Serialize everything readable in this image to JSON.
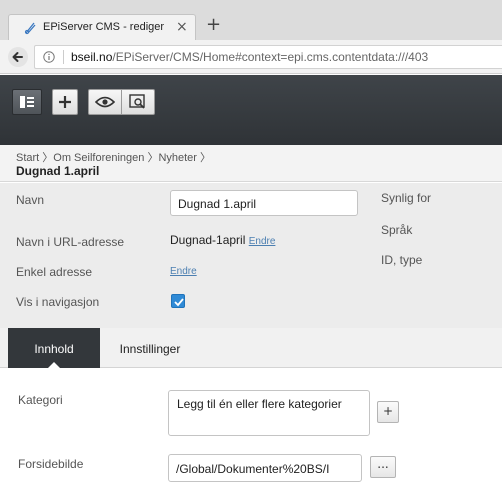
{
  "browser": {
    "tab_title": "EPiServer CMS - rediger",
    "close_glyph": "×",
    "new_tab_glyph": "+",
    "url_host": "bseil.no",
    "url_rest": "/EPiServer/CMS/Home#context=epi.cms.contentdata:///403"
  },
  "toolbar": {
    "icons": [
      "tree-toggle-icon",
      "add-icon",
      "view-icon",
      "preview-icon"
    ]
  },
  "header": {
    "breadcrumb": "Start 〉Om Seilforeningen 〉Nyheter 〉",
    "title": "Dugnad 1.april"
  },
  "properties": {
    "name_label": "Navn",
    "name_value": "Dugnad 1.april",
    "urlname_label": "Navn i URL-adresse",
    "urlname_value": "Dugnad-1april",
    "urlname_edit": "Endre",
    "simple_address_label": "Enkel adresse",
    "simple_address_edit": "Endre",
    "visible_nav_label": "Vis i navigasjon",
    "visible_nav_checked": true,
    "visible_for_label": "Synlig for",
    "language_label": "Språk",
    "id_type_label": "ID, type"
  },
  "tabs": [
    {
      "label": "Innhold",
      "active": true
    },
    {
      "label": "Innstillinger",
      "active": false
    }
  ],
  "content": {
    "category_label": "Kategori",
    "category_value": "Legg til én eller flere kategorier",
    "category_add": "+",
    "front_image_label": "Forsidebilde",
    "front_image_value": "/Global/Dokumenter%20BS/I",
    "front_image_browse": "..."
  },
  "colors": {
    "toolbar_dark": "#2f3337",
    "active_tab": "#33373b",
    "checkbox": "#2f8ad6",
    "link": "#4c7fb1"
  }
}
